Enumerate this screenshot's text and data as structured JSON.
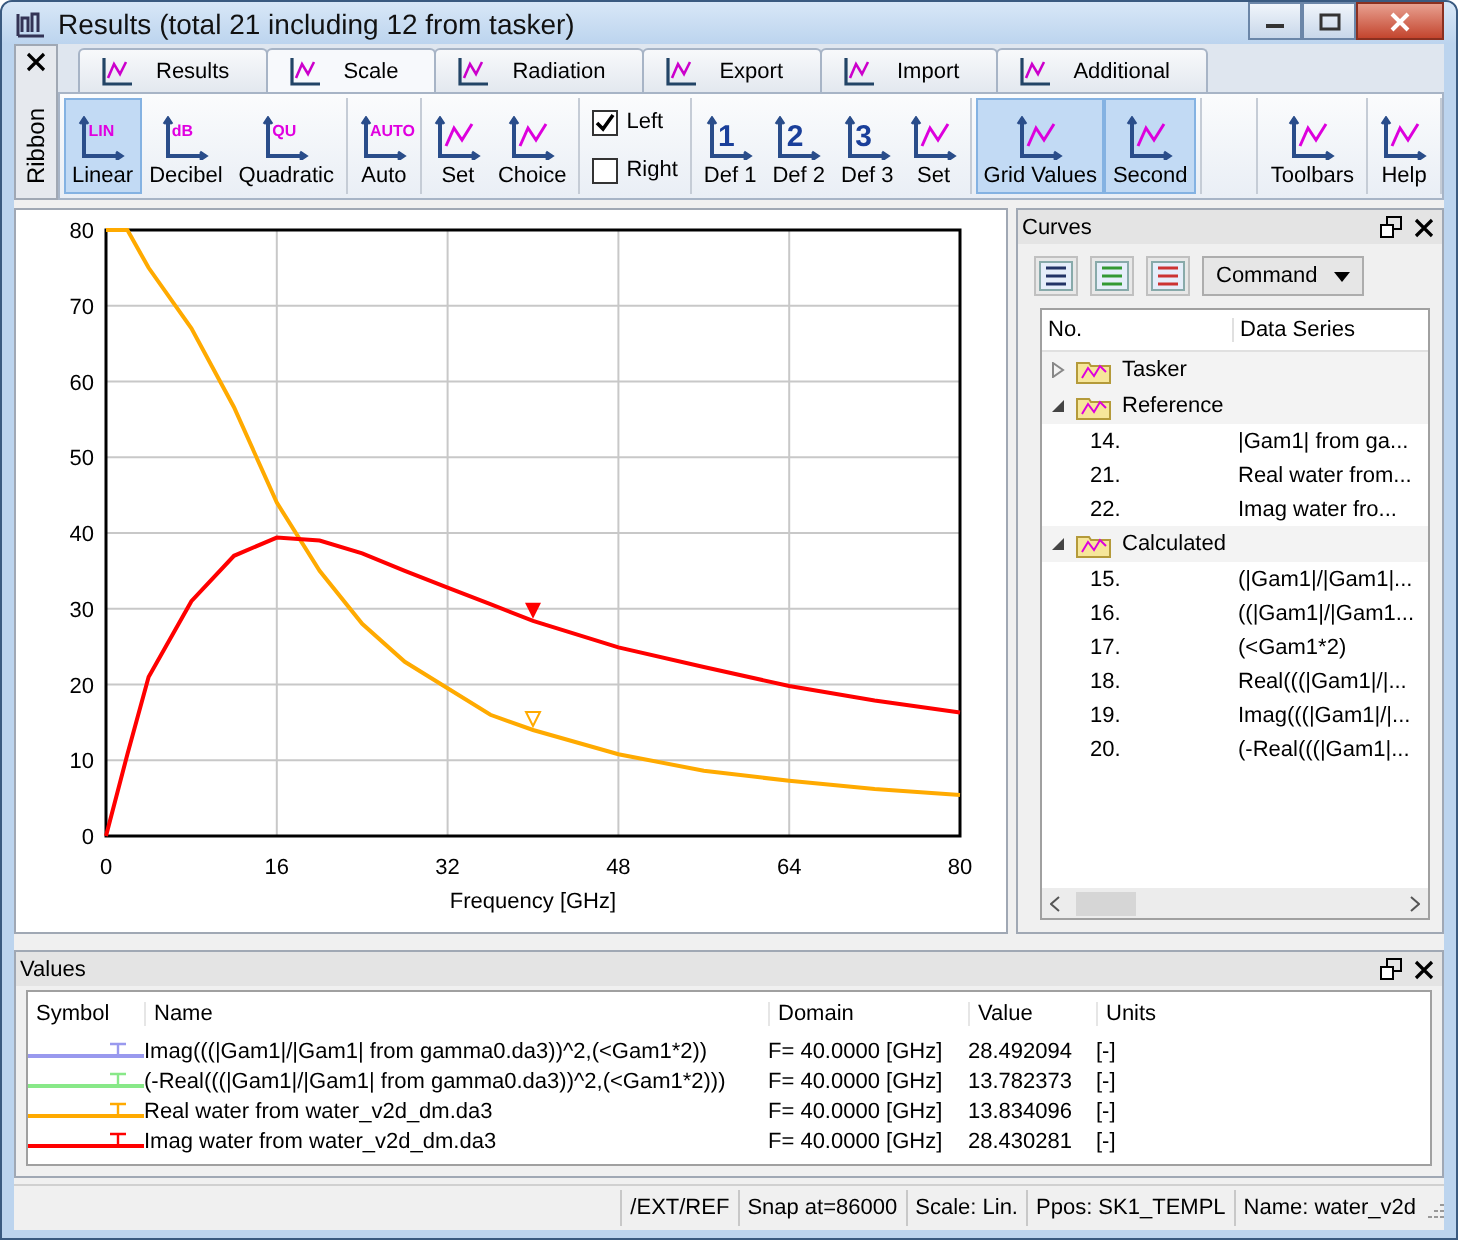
{
  "window": {
    "title": "Results (total 21 including 12 from tasker)"
  },
  "ribbon_label": "Ribbon",
  "tabs": [
    {
      "label": "Results",
      "selected": false
    },
    {
      "label": "Scale",
      "selected": true
    },
    {
      "label": "Radiation",
      "selected": false
    },
    {
      "label": "Export",
      "selected": false
    },
    {
      "label": "Import",
      "selected": false
    },
    {
      "label": "Additional",
      "selected": false
    }
  ],
  "ribbon_groups": [
    {
      "items": [
        {
          "kind": "button",
          "label": "Linear",
          "icon_text": "LIN",
          "selected": true
        },
        {
          "kind": "button",
          "label": "Decibel",
          "icon_text": "dB",
          "selected": false
        },
        {
          "kind": "button",
          "label": "Quadratic",
          "icon_text": "QU",
          "selected": false
        }
      ]
    },
    {
      "items": [
        {
          "kind": "button",
          "label": "Auto",
          "icon_text": "AUTO",
          "selected": false
        }
      ]
    },
    {
      "items": [
        {
          "kind": "button",
          "label": "Set",
          "selected": false
        },
        {
          "kind": "button",
          "label": "Choice",
          "selected": false
        }
      ]
    },
    {
      "items": [
        {
          "kind": "checkbox",
          "label": "Left",
          "checked": true
        },
        {
          "kind": "checkbox",
          "label": "Right",
          "checked": false
        }
      ]
    },
    {
      "items": [
        {
          "kind": "button",
          "label": "Def 1",
          "icon_text": "1",
          "selected": false
        },
        {
          "kind": "button",
          "label": "Def 2",
          "icon_text": "2",
          "selected": false
        },
        {
          "kind": "button",
          "label": "Def 3",
          "icon_text": "3",
          "selected": false
        },
        {
          "kind": "button",
          "label": "Set",
          "selected": false
        }
      ]
    },
    {
      "items": [
        {
          "kind": "button",
          "label": "Grid Values",
          "selected": true
        },
        {
          "kind": "button",
          "label": "Second",
          "selected": true
        }
      ]
    },
    {
      "items": [
        {
          "kind": "button",
          "label": "Toolbars",
          "selected": false
        }
      ]
    },
    {
      "items": [
        {
          "kind": "button",
          "label": "Help",
          "selected": false
        }
      ]
    }
  ],
  "chart": {
    "chart_data": {
      "type": "line",
      "xlabel": "Frequency [GHz]",
      "x": [
        0,
        2,
        4,
        8,
        12,
        16,
        20,
        24,
        28,
        32,
        36,
        40,
        48,
        56,
        64,
        72,
        80
      ],
      "series": [
        {
          "color": "#ffaa00",
          "values": [
            80,
            80,
            75,
            67,
            56.6,
            44,
            35,
            28,
            23,
            19.5,
            16,
            14,
            10.8,
            8.6,
            7.3,
            6.2,
            5.4
          ]
        },
        {
          "color": "#ff0000",
          "values": [
            0,
            10.8,
            21,
            31,
            37,
            39.4,
            39,
            37.3,
            35,
            32.8,
            30.6,
            28.4,
            24.9,
            22.3,
            19.8,
            17.9,
            16.3
          ]
        }
      ],
      "grid": true,
      "xlim": [
        0,
        80
      ],
      "ylim": [
        0,
        80
      ],
      "xticks": [
        0,
        16,
        32,
        48,
        64,
        80
      ],
      "yticks": [
        0,
        10,
        20,
        30,
        40,
        50,
        60,
        70,
        80
      ]
    }
  },
  "curves": {
    "title": "Curves",
    "command": "Command",
    "columns": [
      "No.",
      "Data Series"
    ],
    "groups": [
      {
        "label": "Tasker",
        "expanded": false
      },
      {
        "label": "Reference",
        "expanded": true,
        "children": [
          {
            "no": "14.",
            "series": "|Gam1| from ga..."
          },
          {
            "no": "21.",
            "series": "Real water from..."
          },
          {
            "no": "22.",
            "series": "Imag water fro..."
          }
        ]
      },
      {
        "label": "Calculated",
        "expanded": true,
        "children": [
          {
            "no": "15.",
            "series": "(|Gam1|/|Gam1|..."
          },
          {
            "no": "16.",
            "series": "((|Gam1|/|Gam1..."
          },
          {
            "no": "17.",
            "series": "(<Gam1*2)"
          },
          {
            "no": "18.",
            "series": "Real(((|Gam1|/|..."
          },
          {
            "no": "19.",
            "series": "Imag(((|Gam1|/|..."
          },
          {
            "no": "20.",
            "series": "(-Real(((|Gam1|..."
          }
        ]
      }
    ]
  },
  "values": {
    "title": "Values",
    "columns": [
      "Symbol",
      "Name",
      "Domain",
      "Value",
      "Units"
    ],
    "rows": [
      {
        "color": "#9999ee",
        "name": "Imag(((|Gam1|/|Gam1| from gamma0.da3))^2,(<Gam1*2))",
        "domain": "F= 40.0000 [GHz]",
        "value": "28.492094",
        "units": "[-]"
      },
      {
        "color": "#88e888",
        "name": "(-Real(((|Gam1|/|Gam1| from gamma0.da3))^2,(<Gam1*2)))",
        "domain": "F= 40.0000 [GHz]",
        "value": "13.782373",
        "units": "[-]"
      },
      {
        "color": "#ffaa00",
        "name": "Real water from water_v2d_dm.da3",
        "domain": "F= 40.0000 [GHz]",
        "value": "13.834096",
        "units": "[-]"
      },
      {
        "color": "#ff0000",
        "name": "Imag water from water_v2d_dm.da3",
        "domain": "F= 40.0000 [GHz]",
        "value": "28.430281",
        "units": "[-]"
      }
    ]
  },
  "status_bar": [
    "/EXT/REF",
    "Snap at=86000",
    "Scale: Lin.",
    "Ppos: SK1_TEMPL",
    "Name: water_v2d"
  ]
}
